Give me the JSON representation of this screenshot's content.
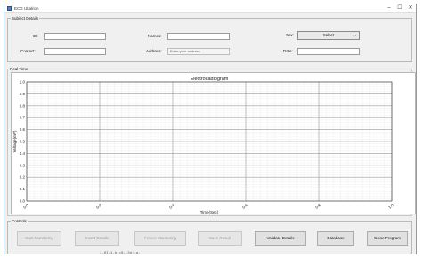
{
  "window": {
    "title": "ECG Ultalrion",
    "minimize": "–",
    "maximize": "☐",
    "close": "✕"
  },
  "subject_details": {
    "group_label": "Subject Details",
    "id_label": "ID:",
    "id_value": "",
    "names_label": "Names:",
    "names_value": "",
    "sex_label": "Sex:",
    "sex_selected": "Select",
    "contact_label": "Contact:",
    "contact_value": "",
    "address_label": "Address:",
    "address_placeholder": "Enter your address",
    "date_label": "Date:",
    "date_value": ""
  },
  "real_time": {
    "group_label": "Real Time"
  },
  "chart_data": {
    "type": "line",
    "title": "Electrocadiogram",
    "xlabel": "Time(Sec)",
    "ylabel": "Voltage(mV)",
    "xlim": [
      0.0,
      1.0
    ],
    "ylim": [
      0.0,
      1.0
    ],
    "xticks": [
      "0.0",
      "0.2",
      "0.4",
      "0.6",
      "0.8",
      "1.0"
    ],
    "yticks": [
      "0.0",
      "0.1",
      "0.2",
      "0.3",
      "0.4",
      "0.5",
      "0.6",
      "0.7",
      "0.8",
      "0.9",
      "1.0"
    ],
    "grid": true,
    "series": []
  },
  "controls": {
    "group_label": "Controls",
    "buttons": [
      {
        "label": "Start Monitoring",
        "enabled": false
      },
      {
        "label": "Insert Details",
        "enabled": false
      },
      {
        "label": "Freeze Monitoring",
        "enabled": false
      },
      {
        "label": "Save Result",
        "enabled": false
      },
      {
        "label": "Validate Details",
        "enabled": true
      },
      {
        "label": "Database",
        "enabled": true
      },
      {
        "label": "Close Program",
        "enabled": true
      }
    ]
  },
  "background_peek": {
    "text": "1.0I.1.b:=0,.3d:.a,"
  }
}
